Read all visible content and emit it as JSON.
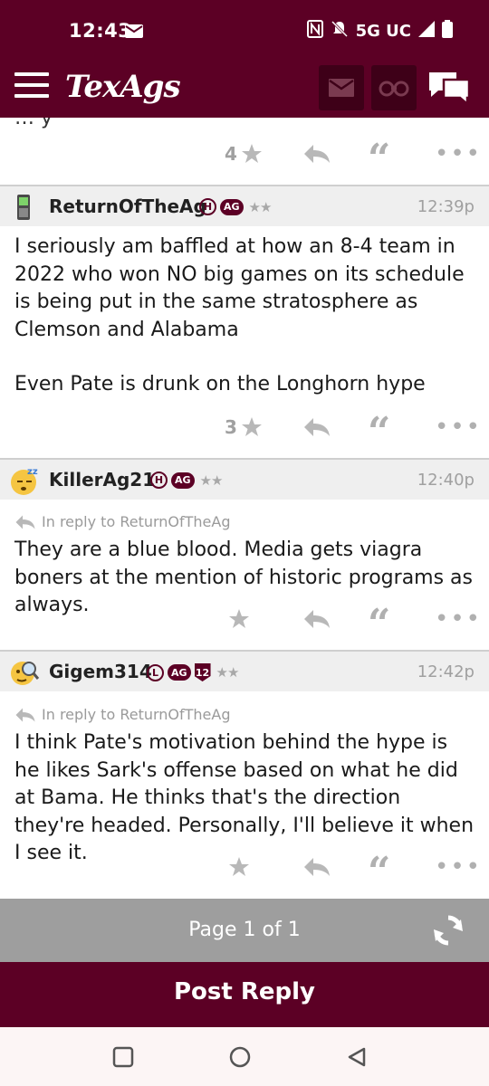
{
  "status": {
    "time": "12:43",
    "network": "5G UC"
  },
  "app": {
    "logo": "TexAgs"
  },
  "feed": {
    "prev_post": {
      "star_count": "4"
    },
    "posts": [
      {
        "username": "ReturnOfTheAg",
        "badges": [
          "H",
          "AG"
        ],
        "rank": "★★",
        "time": "12:39p",
        "in_reply_to": "",
        "paragraphs": [
          "I seriously am baffled at how an 8-4 team in 2022 who won NO big games on its schedule is being put in the same stratosphere as Clemson and Alabama",
          "Even Pate is drunk on the Longhorn hype"
        ],
        "star_count": "3"
      },
      {
        "username": "KillerAg21",
        "badges": [
          "H",
          "AG"
        ],
        "rank": "★★",
        "time": "12:40p",
        "in_reply_to": "In reply to ReturnOfTheAg",
        "paragraphs": [
          "They are a blue blood. Media gets viagra boners at the mention of historic programs as always."
        ],
        "star_count": ""
      },
      {
        "username": "Gigem314",
        "badges": [
          "L",
          "AG",
          "12"
        ],
        "rank": "★★",
        "time": "12:42p",
        "in_reply_to": "In reply to ReturnOfTheAg",
        "paragraphs": [
          "I think Pate's motivation behind the hype is he likes Sark's offense based on what he did at Bama. He thinks that's the direction they're headed. Personally, I'll believe it when I see it."
        ],
        "star_count": ""
      }
    ]
  },
  "pager": {
    "label": "Page 1 of 1"
  },
  "post_reply": {
    "label": "Post Reply"
  },
  "colors": {
    "maroon": "#5c0025",
    "pager_gray": "#9e9e9e"
  },
  "icons": [
    "menu-icon",
    "mail-icon",
    "binoculars-icon",
    "chat-icon",
    "star-icon",
    "reply-icon",
    "quote-icon",
    "more-icon",
    "refresh-icon"
  ]
}
